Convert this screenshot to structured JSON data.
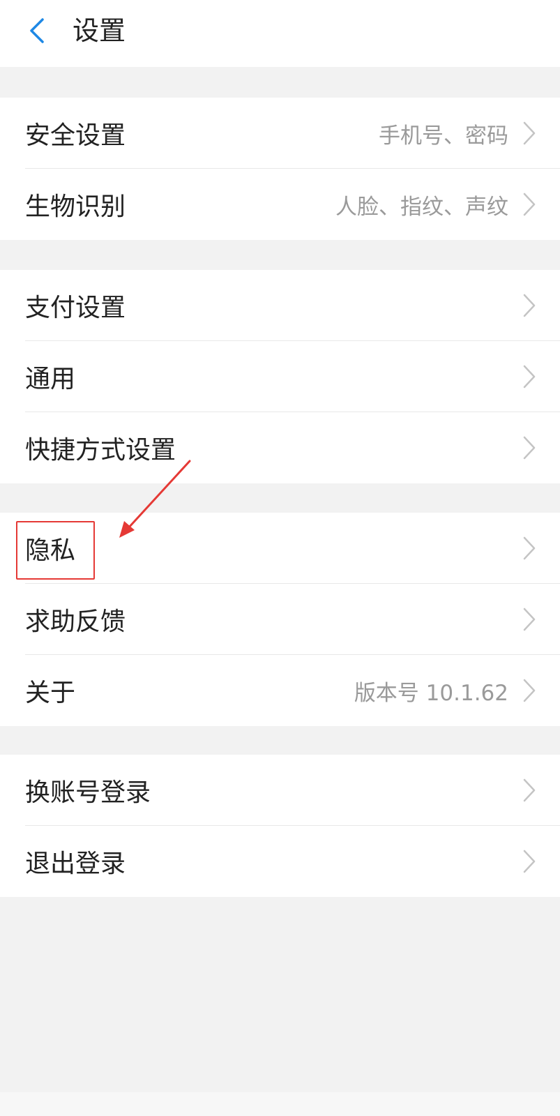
{
  "header": {
    "title": "设置",
    "back_icon": "chevron-left-icon",
    "accent_color": "#1e88e5"
  },
  "groups": [
    {
      "items": [
        {
          "label": "安全设置",
          "value": "手机号、密码"
        },
        {
          "label": "生物识别",
          "value": "人脸、指纹、声纹"
        }
      ]
    },
    {
      "items": [
        {
          "label": "支付设置",
          "value": ""
        },
        {
          "label": "通用",
          "value": ""
        },
        {
          "label": "快捷方式设置",
          "value": ""
        }
      ]
    },
    {
      "items": [
        {
          "label": "隐私",
          "value": ""
        },
        {
          "label": "求助反馈",
          "value": ""
        },
        {
          "label": "关于",
          "value": "版本号 10.1.62"
        }
      ]
    },
    {
      "items": [
        {
          "label": "换账号登录",
          "value": ""
        },
        {
          "label": "退出登录",
          "value": ""
        }
      ]
    }
  ],
  "annotation": {
    "highlighted_item": "隐私",
    "color": "#e53935"
  }
}
